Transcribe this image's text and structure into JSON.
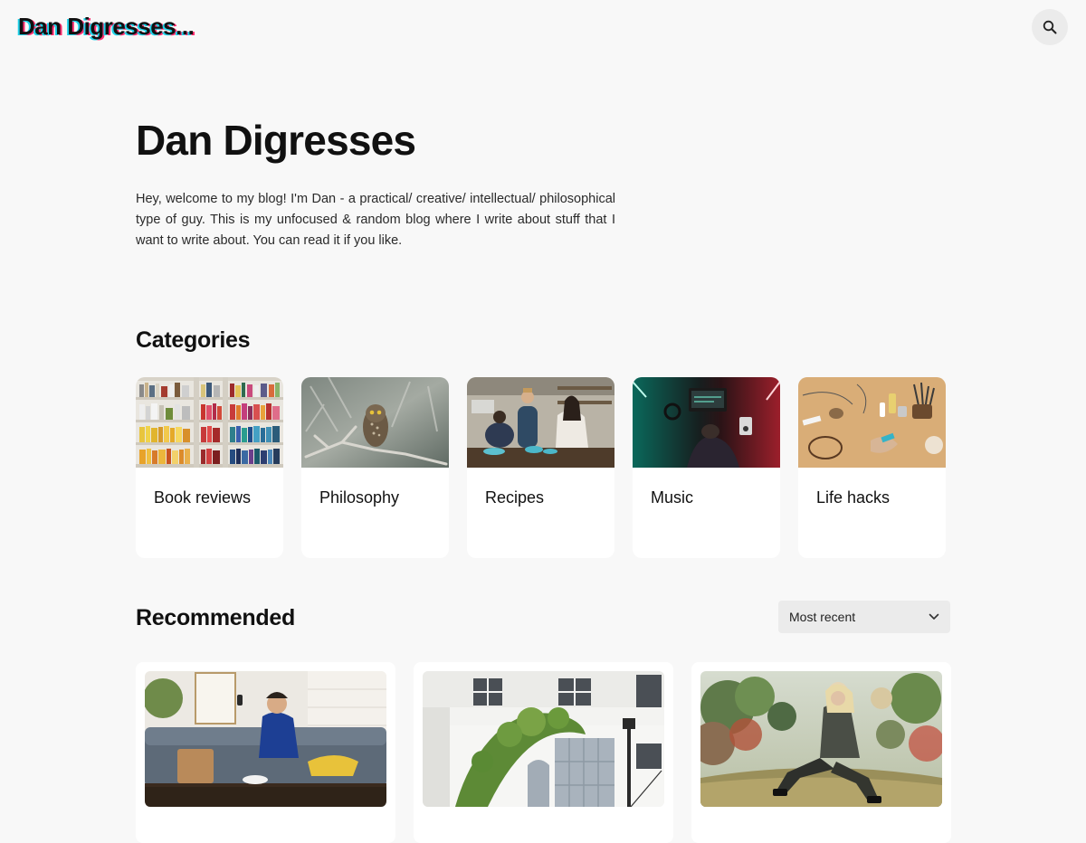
{
  "header": {
    "logo_text": "Dan Digresses...",
    "search_icon": "search-icon"
  },
  "hero": {
    "title": "Dan Digresses",
    "intro": "Hey, welcome to my blog! I'm Dan - a practical/ creative/ intellectual/ philosophical type of guy. This is my unfocused & random blog where I write about stuff that I want to write about. You can read it if you like."
  },
  "categories": {
    "title": "Categories",
    "items": [
      {
        "label": "Book reviews"
      },
      {
        "label": "Philosophy"
      },
      {
        "label": "Recipes"
      },
      {
        "label": "Music"
      },
      {
        "label": "Life hacks"
      }
    ]
  },
  "recommended": {
    "title": "Recommended",
    "sort_value": "Most recent",
    "sort_icon": "chevron-down-icon"
  },
  "colors": {
    "background": "#f8f8f8",
    "card": "#ffffff",
    "logo_cyan": "#1fd1e8",
    "logo_pink": "#ff2d6f"
  }
}
